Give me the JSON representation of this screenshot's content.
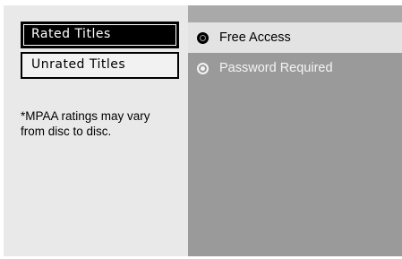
{
  "sidebar": {
    "tabs": [
      {
        "label": "Rated Titles",
        "selected": true
      },
      {
        "label": "Unrated Titles",
        "selected": false
      }
    ],
    "note": "*MPAA ratings may vary from disc to disc."
  },
  "options": [
    {
      "label": "Free Access",
      "checked": true
    },
    {
      "label": "Password Required",
      "checked": false
    }
  ],
  "colors": {
    "left_panel": "#e9e9e9",
    "right_panel": "#9a9a9a",
    "selected_row": "#e3e3e3",
    "selected_tab": "#000000"
  }
}
